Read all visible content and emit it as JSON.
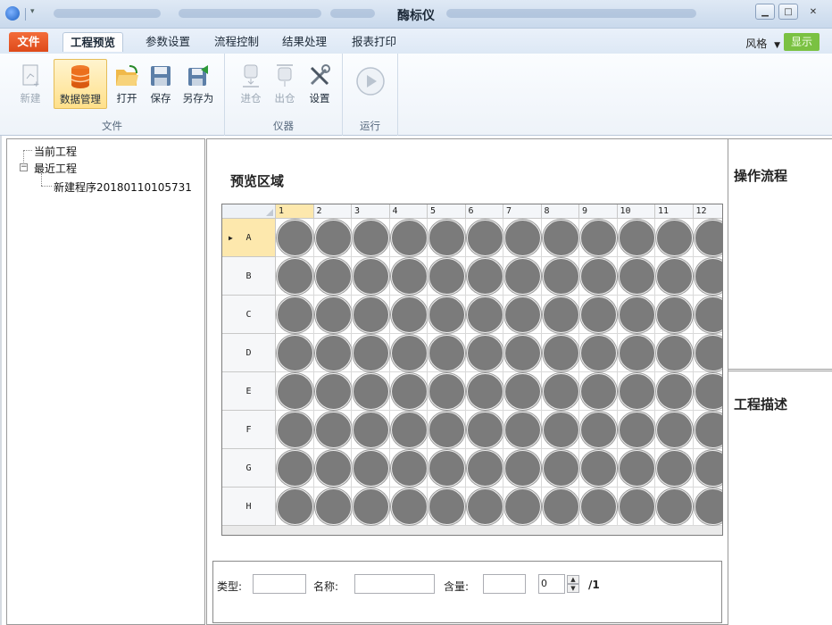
{
  "window": {
    "title": "酶标仪"
  },
  "tabs": [
    {
      "label": "文件"
    },
    {
      "label": "工程预览"
    },
    {
      "label": "参数设置"
    },
    {
      "label": "流程控制"
    },
    {
      "label": "结果处理"
    },
    {
      "label": "报表打印"
    }
  ],
  "right_menu": {
    "style_label": "风格",
    "display_label": "显示"
  },
  "ribbon": {
    "file_group": {
      "label": "文件",
      "buttons": [
        {
          "label": "新建",
          "icon": "new-doc-icon",
          "enabled": false
        },
        {
          "label": "数据管理",
          "icon": "database-icon",
          "enabled": true,
          "selected": true
        },
        {
          "label": "打开",
          "icon": "folder-open-icon",
          "enabled": true
        },
        {
          "label": "保存",
          "icon": "save-icon",
          "enabled": true
        },
        {
          "label": "另存为",
          "icon": "save-as-icon",
          "enabled": true
        }
      ]
    },
    "instrument_group": {
      "label": "仪器",
      "buttons": [
        {
          "label": "进仓",
          "icon": "tray-in-icon",
          "enabled": false
        },
        {
          "label": "出仓",
          "icon": "tray-out-icon",
          "enabled": false
        },
        {
          "label": "设置",
          "icon": "tools-icon",
          "enabled": true
        }
      ]
    },
    "run_group": {
      "label": "运行",
      "buttons": [
        {
          "label": "",
          "icon": "play-icon",
          "enabled": false
        }
      ]
    }
  },
  "tree": {
    "current_project": "当前工程",
    "recent_projects": "最近工程",
    "recent_items": [
      "新建程序20180110105731"
    ]
  },
  "preview": {
    "title": "预览区域",
    "columns": [
      "1",
      "2",
      "3",
      "4",
      "5",
      "6",
      "7",
      "8",
      "9",
      "10",
      "11",
      "12"
    ],
    "rows": [
      "A",
      "B",
      "C",
      "D",
      "E",
      "F",
      "G",
      "H"
    ],
    "selected_row": "A",
    "selected_column": "1",
    "well_color": "#7b7b7b"
  },
  "sample_bar": {
    "type_label": "类型:",
    "type_value": "",
    "name_label": "名称:",
    "name_value": "",
    "amount_label": "含量:",
    "amount_value": "",
    "page_value": "0",
    "page_total": "/1"
  },
  "right": {
    "operation_flow_title": "操作流程",
    "project_description_title": "工程描述"
  }
}
